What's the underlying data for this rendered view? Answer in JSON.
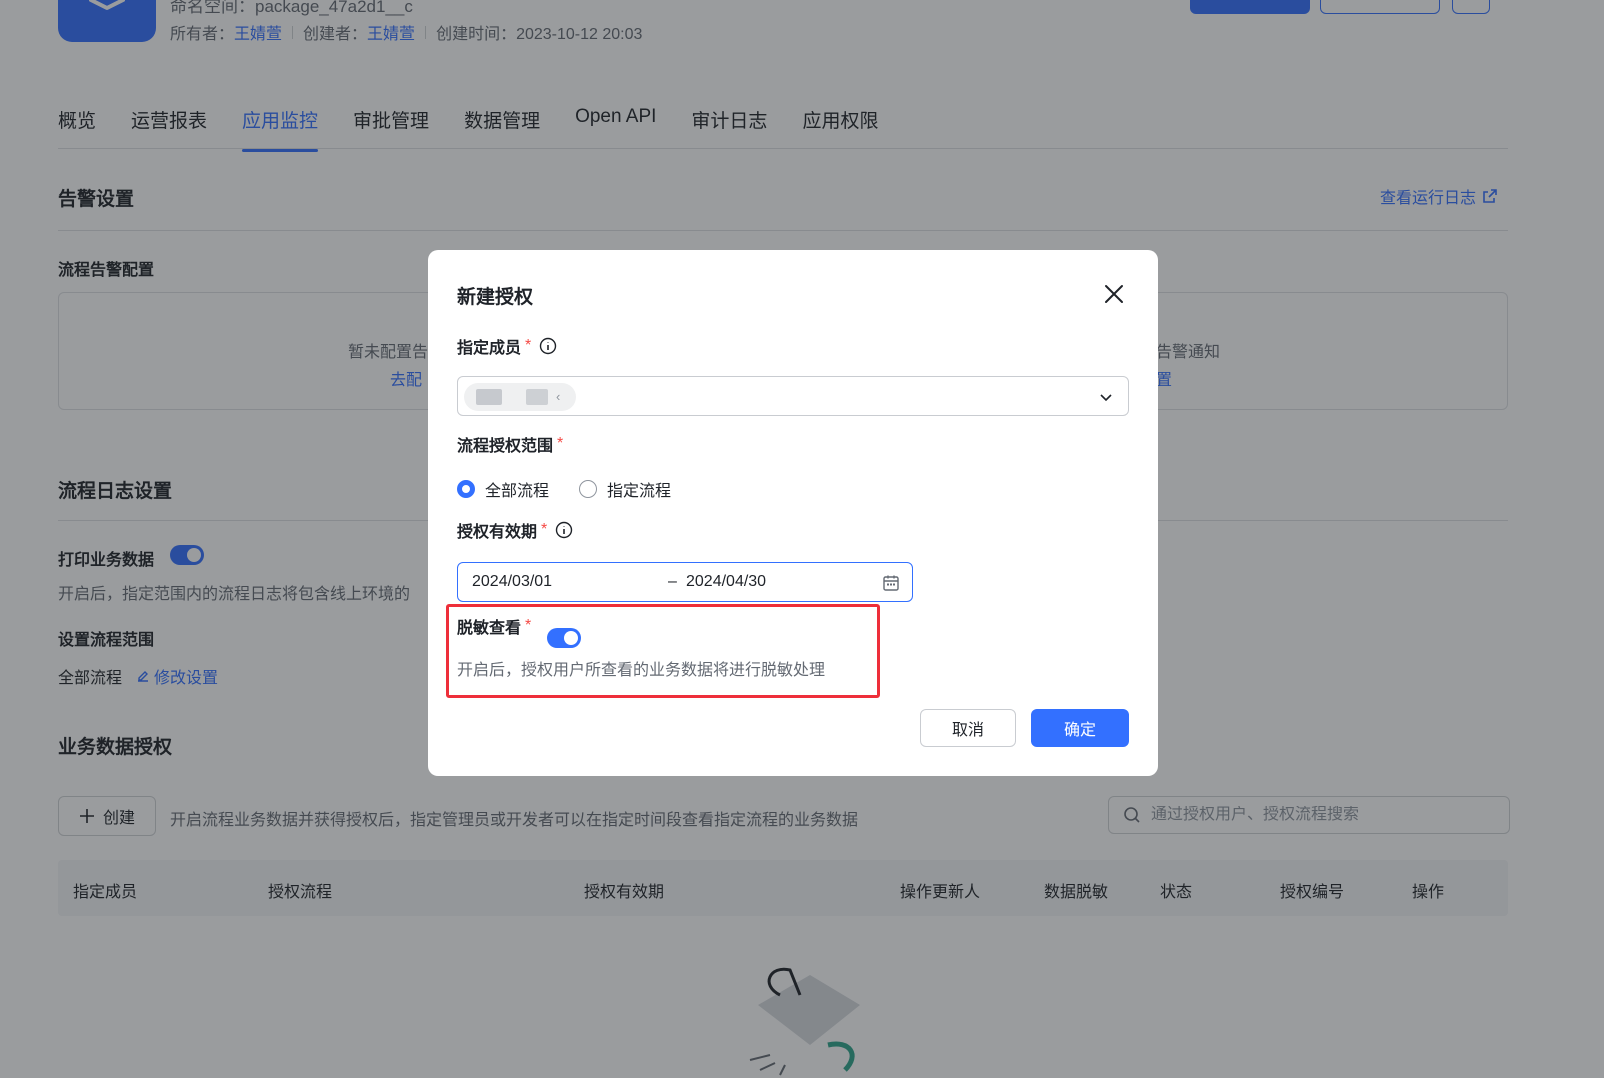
{
  "header": {
    "namespace_label": "命名空间：package_47a2d1__c",
    "owner_label": "所有者：",
    "owner_name": "王婧萱",
    "creator_label": "创建者：",
    "creator_name": "王婧萱",
    "created_time": "创建时间：2023-10-12 20:03"
  },
  "tabs": [
    {
      "label": "概览"
    },
    {
      "label": "运营报表"
    },
    {
      "label": "应用监控",
      "active": true
    },
    {
      "label": "审批管理"
    },
    {
      "label": "数据管理"
    },
    {
      "label": "Open API"
    },
    {
      "label": "审计日志"
    },
    {
      "label": "应用权限"
    }
  ],
  "alarm": {
    "title": "告警设置",
    "run_log_link": "查看运行日志",
    "flow_alarm_title": "流程告警配置",
    "empty_left": "暂未配置告",
    "empty_left_link": "去配",
    "empty_right": "告警通知",
    "empty_right_link": "置"
  },
  "flow_log": {
    "title": "流程日志设置",
    "print_label": "打印业务数据",
    "print_desc": "开启后，指定范围内的流程日志将包含线上环境的",
    "scope_title": "设置流程范围",
    "scope_value": "全部流程",
    "scope_edit": "修改设置"
  },
  "data_auth": {
    "title": "业务数据授权",
    "create_button": "创建",
    "desc": "开启流程业务数据并获得授权后，指定管理员或开发者可以在指定时间段查看指定流程的业务数据",
    "search_placeholder": "通过授权用户、授权流程搜索",
    "columns": [
      "指定成员",
      "授权流程",
      "授权有效期",
      "操作更新人",
      "数据脱敏",
      "状态",
      "授权编号",
      "操作"
    ]
  },
  "modal": {
    "title": "新建授权",
    "member_label": "指定成员",
    "scope_label": "流程授权范围",
    "scope_options": [
      "全部流程",
      "指定流程"
    ],
    "scope_selected": "全部流程",
    "validity_label": "授权有效期",
    "date_start": "2024/03/01",
    "date_separator": "–",
    "date_end": "2024/04/30",
    "desensitize_label": "脱敏查看",
    "desensitize_enabled": true,
    "desensitize_desc": "开启后，授权用户所查看的业务数据将进行脱敏处理",
    "required_mark": "*",
    "cancel_button": "取消",
    "confirm_button": "确定"
  },
  "colors": {
    "accent": "#3370ff",
    "highlight_border": "#ee2f3a",
    "required": "#f54a45"
  }
}
